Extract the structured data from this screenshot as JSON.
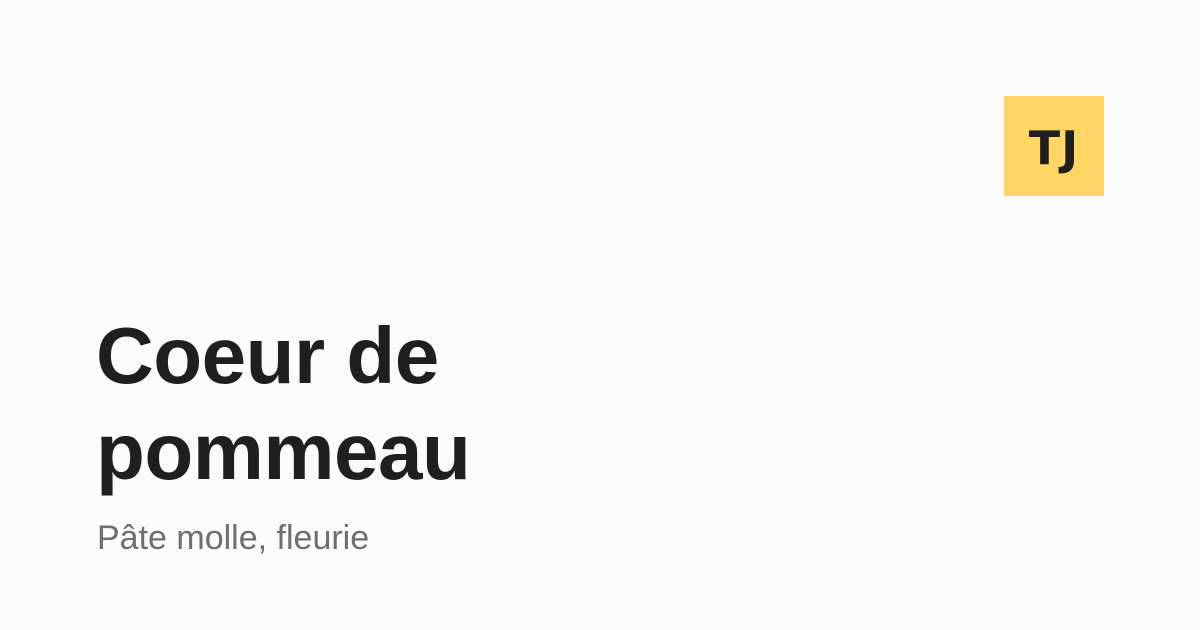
{
  "colors": {
    "background": "#fbfbfb",
    "logo_background": "#ffd665",
    "logo_text": "#1f1f1f",
    "title": "#1f1f1f",
    "subtitle": "#6e6e6e"
  },
  "logo": {
    "text": "TJ"
  },
  "title": {
    "line1": "Coeur de",
    "line2": "pommeau"
  },
  "subtitle": {
    "text": "Pâte molle, fleurie"
  }
}
